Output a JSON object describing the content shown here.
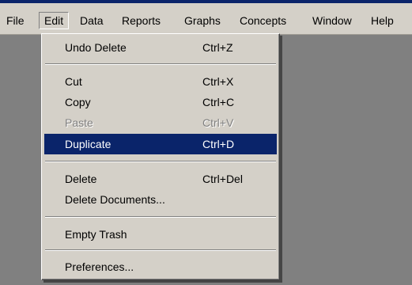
{
  "menubar": {
    "items": [
      {
        "label": "File"
      },
      {
        "label": "Edit"
      },
      {
        "label": "Data"
      },
      {
        "label": "Reports"
      },
      {
        "label": "Graphs"
      },
      {
        "label": "Concepts"
      },
      {
        "label": "Window"
      },
      {
        "label": "Help"
      }
    ]
  },
  "edit_menu": {
    "undo_delete": {
      "label": "Undo Delete",
      "shortcut": "Ctrl+Z"
    },
    "cut": {
      "label": "Cut",
      "shortcut": "Ctrl+X"
    },
    "copy": {
      "label": "Copy",
      "shortcut": "Ctrl+C"
    },
    "paste": {
      "label": "Paste",
      "shortcut": "Ctrl+V",
      "enabled": false
    },
    "duplicate": {
      "label": "Duplicate",
      "shortcut": "Ctrl+D",
      "highlighted": true
    },
    "delete": {
      "label": "Delete",
      "shortcut": "Ctrl+Del"
    },
    "delete_documents": {
      "label": "Delete Documents..."
    },
    "empty_trash": {
      "label": "Empty Trash"
    },
    "preferences": {
      "label": "Preferences..."
    }
  },
  "colors": {
    "menu_face": "#d4d0c8",
    "workspace": "#808080",
    "highlight": "#0a246a",
    "highlight_text": "#ffffff",
    "disabled_text": "#808080"
  }
}
